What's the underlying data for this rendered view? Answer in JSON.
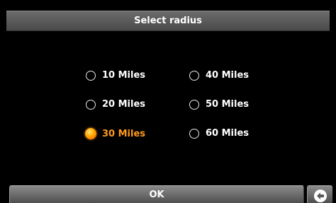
{
  "dialog": {
    "title": "Select radius"
  },
  "options": [
    {
      "label": "10 Miles",
      "selected": false
    },
    {
      "label": "20 Miles",
      "selected": false
    },
    {
      "label": "30 Miles",
      "selected": true
    },
    {
      "label": "40 Miles",
      "selected": false
    },
    {
      "label": "50 Miles",
      "selected": false
    },
    {
      "label": "60 Miles",
      "selected": false
    }
  ],
  "footer": {
    "ok_label": "OK",
    "back_icon": "back-arrow-icon"
  },
  "colors": {
    "selected_text": "#ff9a1c",
    "background": "#000000",
    "bar_gradient_top": "#6c6c6c",
    "bar_gradient_bottom": "#4a4a4a"
  }
}
